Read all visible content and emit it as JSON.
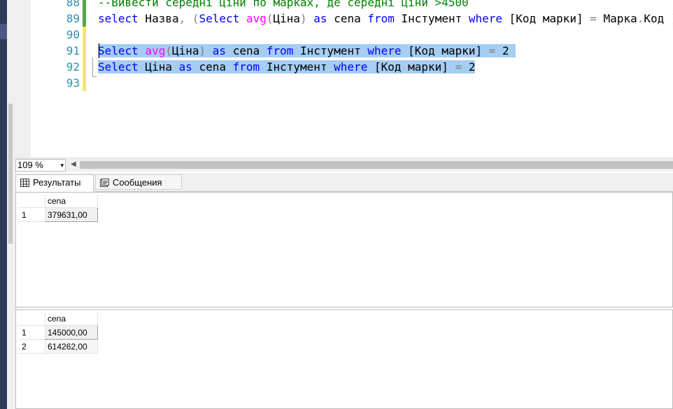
{
  "editor": {
    "lines": [
      {
        "num": "88",
        "change": "green",
        "tokens": [
          {
            "t": "--Вивести середні ціни по марках, де середні ціни >4500",
            "c": "cm"
          }
        ]
      },
      {
        "num": "89",
        "change": "green",
        "tokens": [
          {
            "t": "select",
            "c": "kw"
          },
          {
            "t": " Назва",
            "c": ""
          },
          {
            "t": ", ",
            "c": "op"
          },
          {
            "t": "(",
            "c": "op"
          },
          {
            "t": "Select",
            "c": "kw"
          },
          {
            "t": " ",
            "c": ""
          },
          {
            "t": "avg",
            "c": "fn"
          },
          {
            "t": "(",
            "c": "op"
          },
          {
            "t": "Ціна",
            "c": ""
          },
          {
            "t": ")",
            "c": "op"
          },
          {
            "t": " ",
            "c": ""
          },
          {
            "t": "as",
            "c": "kw"
          },
          {
            "t": " cena ",
            "c": ""
          },
          {
            "t": "from",
            "c": "kw"
          },
          {
            "t": " Інстумент ",
            "c": ""
          },
          {
            "t": "where",
            "c": "kw"
          },
          {
            "t": " [Код марки] ",
            "c": ""
          },
          {
            "t": "=",
            "c": "op"
          },
          {
            "t": " Марка",
            "c": ""
          },
          {
            "t": ".",
            "c": "op"
          },
          {
            "t": "Код ",
            "c": ""
          },
          {
            "t": ")",
            "c": "op"
          }
        ]
      },
      {
        "num": "90",
        "change": "yellow",
        "tokens": []
      },
      {
        "num": "91",
        "change": "yellow",
        "selected": true,
        "tokens": [
          {
            "t": "Select",
            "c": "kw"
          },
          {
            "t": " ",
            "c": ""
          },
          {
            "t": "avg",
            "c": "fn"
          },
          {
            "t": "(",
            "c": "op"
          },
          {
            "t": "Ціна",
            "c": ""
          },
          {
            "t": ")",
            "c": "op"
          },
          {
            "t": " ",
            "c": ""
          },
          {
            "t": "as",
            "c": "kw"
          },
          {
            "t": " cena ",
            "c": ""
          },
          {
            "t": "from",
            "c": "kw"
          },
          {
            "t": " Інстумент ",
            "c": ""
          },
          {
            "t": "where",
            "c": "kw"
          },
          {
            "t": " [Код марки] ",
            "c": ""
          },
          {
            "t": "=",
            "c": "op"
          },
          {
            "t": " 2 ",
            "c": ""
          }
        ]
      },
      {
        "num": "92",
        "change": "yellow",
        "selected": true,
        "tokens": [
          {
            "t": "Select",
            "c": "kw"
          },
          {
            "t": " Ціна ",
            "c": ""
          },
          {
            "t": "as",
            "c": "kw"
          },
          {
            "t": " cena ",
            "c": ""
          },
          {
            "t": "from",
            "c": "kw"
          },
          {
            "t": " Інстумент ",
            "c": ""
          },
          {
            "t": "where",
            "c": "kw"
          },
          {
            "t": " [Код марки] ",
            "c": ""
          },
          {
            "t": "=",
            "c": "op"
          },
          {
            "t": " 2",
            "c": ""
          }
        ]
      },
      {
        "num": "93",
        "change": "yellow",
        "tokens": []
      }
    ]
  },
  "zoom": {
    "value": "109 %",
    "arrow": "▾"
  },
  "tabs": {
    "results": "Результаты",
    "messages": "Сообщения"
  },
  "grid1": {
    "column": "cena",
    "rows": [
      {
        "n": "1",
        "v": "379631,00"
      }
    ]
  },
  "grid2": {
    "column": "cena",
    "rows": [
      {
        "n": "1",
        "v": "145000,00"
      },
      {
        "n": "2",
        "v": "614262,00"
      }
    ]
  },
  "colors": {
    "keyword": "#0000ff",
    "function": "#ff00ff",
    "comment": "#008000",
    "line_number": "#2b91af",
    "selection": "#a6cdf2"
  }
}
